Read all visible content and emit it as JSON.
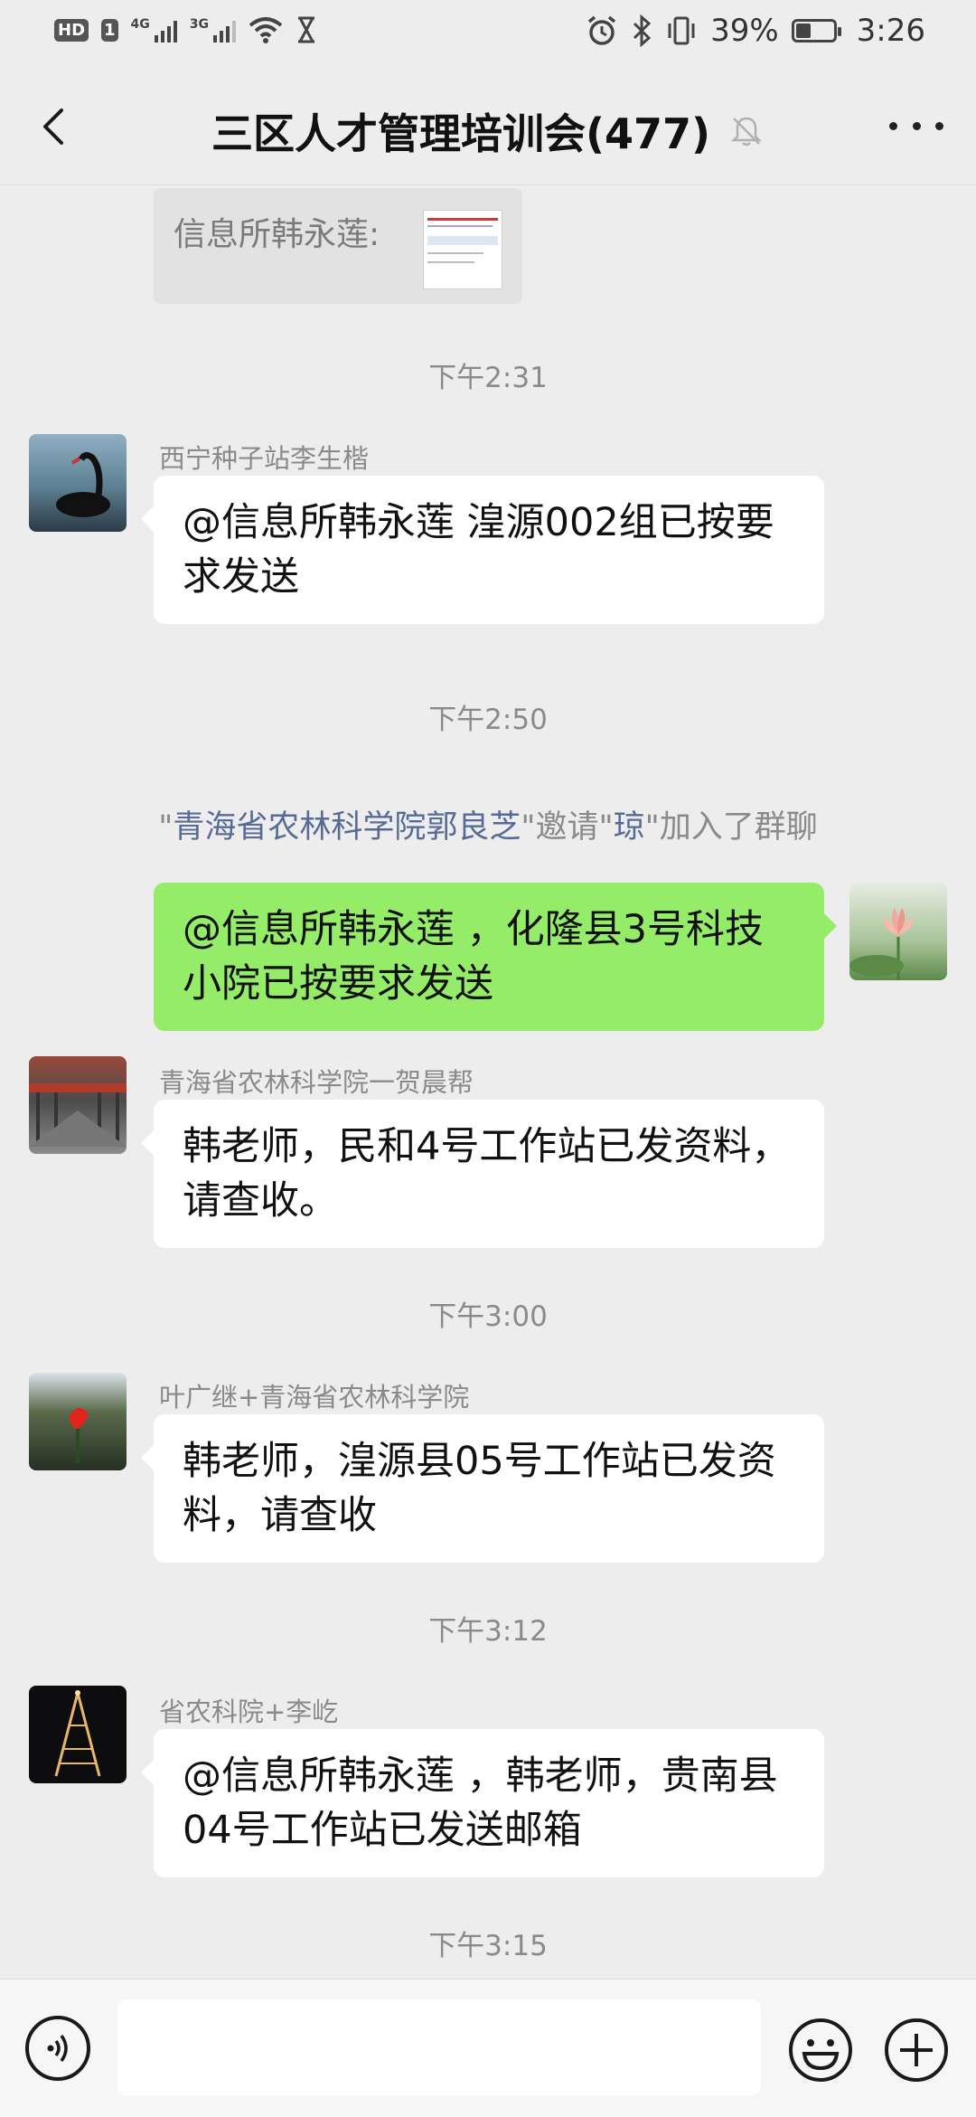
{
  "status_bar": {
    "hd": "HD",
    "sim1": "1",
    "net1": "4G",
    "net2": "3G",
    "battery": "39%",
    "battery_level": 0.39,
    "time": "3:26"
  },
  "header": {
    "title": "三区人才管理培训会(477)"
  },
  "quoted": {
    "text": "信息所韩永莲:"
  },
  "messages": [
    {
      "time": "下午2:31",
      "sender": "西宁种子站李生楷",
      "text": "@信息所韩永莲  湟源002组已按要求发送"
    },
    {
      "time": "下午2:50"
    },
    {
      "sender": "",
      "text": "@信息所韩永莲 ，化隆县3号科技小院已按要求发送"
    },
    {
      "sender": "青海省农林科学院一贺晨帮",
      "text": "韩老师，民和4号工作站已发资料，请查收。"
    },
    {
      "time": "下午3:00",
      "sender": "叶广继+青海省农林科学院",
      "text": "韩老师，湟源县05号工作站已发资料，请查收"
    },
    {
      "time": "下午3:12",
      "sender": "省农科院+李屹",
      "text": "@信息所韩永莲 ，韩老师，贵南县04号工作站已发送邮箱"
    },
    {
      "time": "下午3:15"
    }
  ],
  "system_notice": {
    "q1": "\"",
    "inviter": "青海省农林科学院郭良芝",
    "q2": "\"邀请\"",
    "invitee": "琼",
    "q3": "\"加入了群聊"
  },
  "icons": {
    "back": "chevron-left-icon",
    "mute": "bell-off-icon",
    "more": "more-dots-icon",
    "voice": "voice-icon",
    "emoji": "emoji-icon",
    "plus": "plus-icon"
  }
}
